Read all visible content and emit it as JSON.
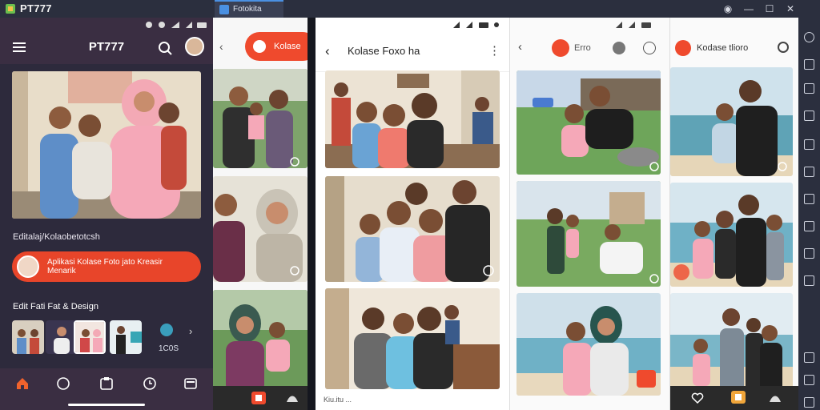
{
  "app": {
    "name": "PT777",
    "tab_label": "Fotokita"
  },
  "window_controls": [
    "◉",
    "—",
    "☐",
    "✕"
  ],
  "panel1": {
    "title": "PT777",
    "section1": "Editalaj/Kolaobetotcsh",
    "cta_text": "Aplikasi Kolase Foto jato Kreasir Menarik",
    "section2": "Edit Fati Fat & Design",
    "more_label": "1C0S",
    "nav_icons": [
      "home-icon",
      "chat-icon",
      "tag-icon",
      "clock-icon",
      "gallery-icon"
    ],
    "accent": "#e8452a"
  },
  "panel2": {
    "pill_label": "Kolase"
  },
  "panel3": {
    "title": "Kolase Foxo ha",
    "footer_text": "Kiu.itu ..."
  },
  "panel4": {
    "label": "Erro"
  },
  "panel5": {
    "title": "Kodase tlioro"
  },
  "colors": {
    "dark_bg": "#2d2a3c",
    "header_bg": "#3a2e42",
    "brand": "#ef4a2d"
  }
}
